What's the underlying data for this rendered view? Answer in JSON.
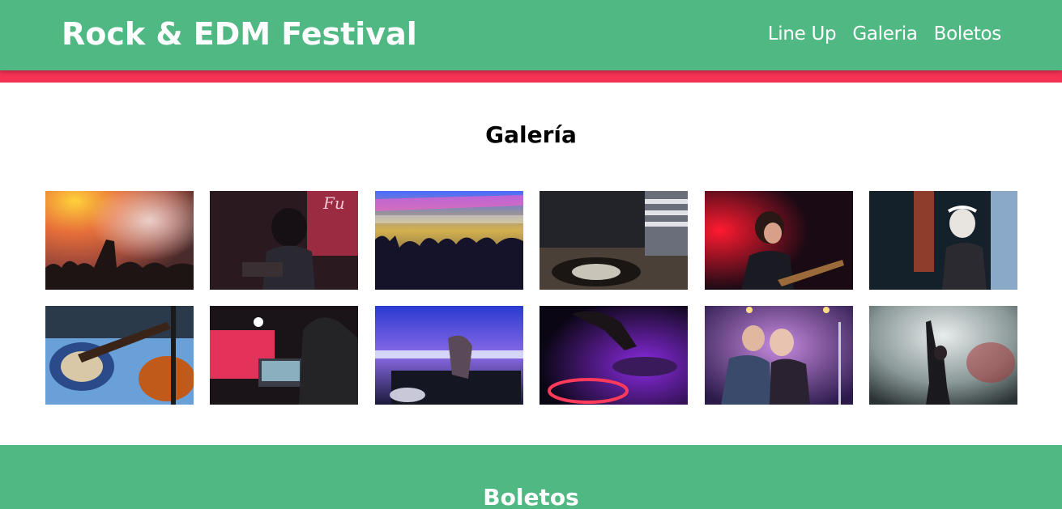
{
  "header": {
    "title": "Rock & EDM Festival",
    "nav": [
      "Line Up",
      "Galeria",
      "Boletos"
    ]
  },
  "gallery": {
    "title": "Galería",
    "photos": [
      "concert-crowd-hands-photo",
      "rock-singer-microphone-photo",
      "edm-crowd-lights-photo",
      "dj-turntables-photo",
      "guitarist-singing-photo",
      "female-dj-headphones-photo",
      "electric-guitars-closeup-photo",
      "dj-laptop-club-photo",
      "dj-mixer-hands-photo",
      "dj-neon-purple-photo",
      "rock-duo-stage-photo",
      "performer-smoke-photo"
    ]
  },
  "tickets": {
    "title": "Boletos"
  },
  "colors": {
    "header_bg": "#50b883",
    "accent_bar": "#f33254",
    "text_light": "#ffffff"
  }
}
